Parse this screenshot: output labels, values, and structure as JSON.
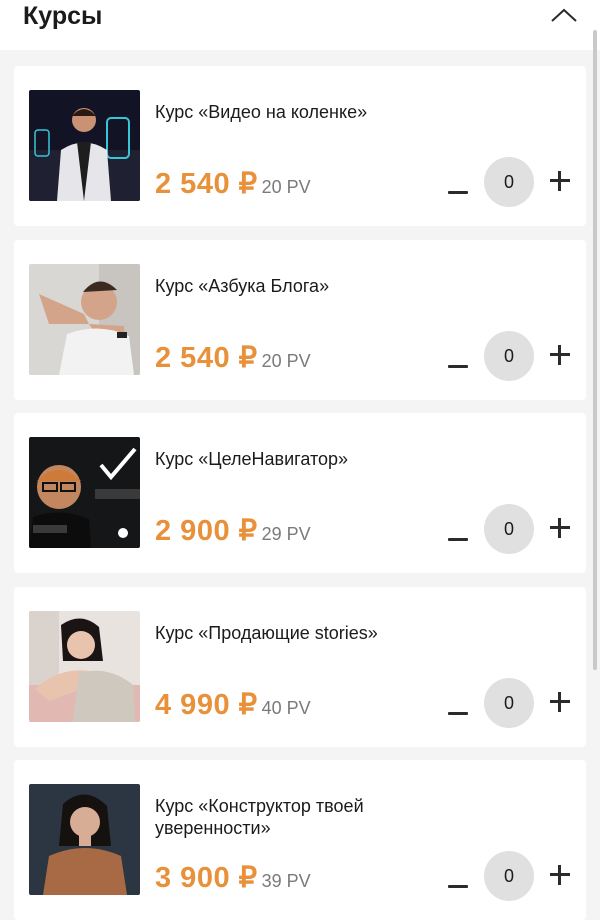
{
  "header": {
    "title": "Курсы",
    "collapse_icon": "chevron-up-icon"
  },
  "courses": [
    {
      "title": "Курс «Видео на коленке»",
      "price": "2 540 ₽",
      "pv": "20 PV",
      "quantity": "0",
      "image": "man-with-phone-screens"
    },
    {
      "title": "Курс «Азбука Блога»",
      "price": "2 540 ₽",
      "pv": "20 PV",
      "quantity": "0",
      "image": "man-framing-hands"
    },
    {
      "title": "Курс «ЦелеНавигатор»",
      "price": "2 900 ₽",
      "pv": "29 PV",
      "quantity": "0",
      "image": "man-with-glasses-chalkboard"
    },
    {
      "title": "Курс «Продающие stories»",
      "price": "4 990 ₽",
      "pv": "40 PV",
      "quantity": "0",
      "image": "woman-on-sofa"
    },
    {
      "title": "Курс «Конструктор твоей уверенности»",
      "price": "3 900 ₽",
      "pv": "39 PV",
      "quantity": "0",
      "image": "woman-in-brown-sweater"
    }
  ],
  "colors": {
    "accent_price": "#e8913a",
    "background": "#f4f4f4",
    "card": "#ffffff",
    "quantity_circle": "#e0e0e0"
  }
}
